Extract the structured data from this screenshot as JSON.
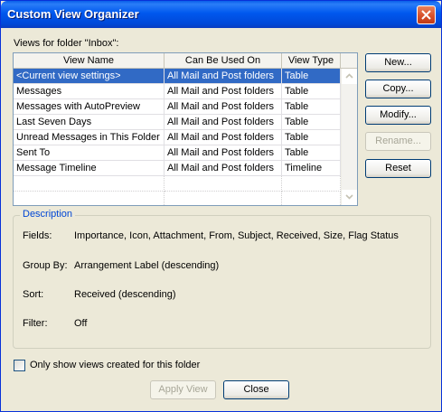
{
  "window": {
    "title": "Custom View Organizer"
  },
  "views_label": "Views for folder \"Inbox\":",
  "list": {
    "columns": [
      "View Name",
      "Can Be Used On",
      "View Type"
    ],
    "rows": [
      {
        "name": "<Current view settings>",
        "used_on": "All Mail and Post folders",
        "type": "Table",
        "selected": true
      },
      {
        "name": "Messages",
        "used_on": "All Mail and Post folders",
        "type": "Table",
        "selected": false
      },
      {
        "name": "Messages with AutoPreview",
        "used_on": "All Mail and Post folders",
        "type": "Table",
        "selected": false
      },
      {
        "name": "Last Seven Days",
        "used_on": "All Mail and Post folders",
        "type": "Table",
        "selected": false
      },
      {
        "name": "Unread Messages in This Folder",
        "used_on": "All Mail and Post folders",
        "type": "Table",
        "selected": false
      },
      {
        "name": "Sent To",
        "used_on": "All Mail and Post folders",
        "type": "Table",
        "selected": false
      },
      {
        "name": "Message Timeline",
        "used_on": "All Mail and Post folders",
        "type": "Timeline",
        "selected": false
      }
    ]
  },
  "side_buttons": {
    "new": "New...",
    "copy": "Copy...",
    "modify": "Modify...",
    "rename": "Rename...",
    "reset": "Reset"
  },
  "description": {
    "legend": "Description",
    "fields_label": "Fields:",
    "fields_value": "Importance, Icon, Attachment, From, Subject, Received, Size, Flag Status",
    "group_label": "Group By:",
    "group_value": "Arrangement Label (descending)",
    "sort_label": "Sort:",
    "sort_value": "Received (descending)",
    "filter_label": "Filter:",
    "filter_value": "Off"
  },
  "only_show_checkbox": {
    "label": "Only show views created for this folder",
    "checked": false
  },
  "footer_buttons": {
    "apply": "Apply View",
    "close": "Close"
  },
  "colors": {
    "titlebar": "#0058ee",
    "selection": "#316ac5",
    "dialog_bg": "#ece9d8",
    "legend_text": "#0046d5"
  }
}
